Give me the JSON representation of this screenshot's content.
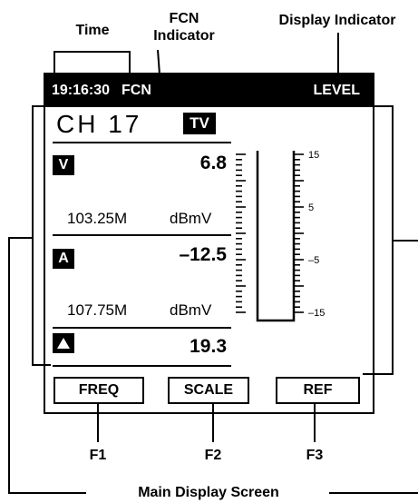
{
  "callouts": {
    "time": "Time",
    "fcn_line1": "FCN",
    "fcn_line2": "Indicator",
    "display_indicator": "Display Indicator",
    "main_display_screen": "Main Display Screen"
  },
  "status_bar": {
    "time": "19:16:30",
    "fcn": "FCN",
    "mode": "LEVEL"
  },
  "channel": {
    "label": "CH 17",
    "badge": "TV"
  },
  "video": {
    "badge": "V",
    "level": "6.8",
    "frequency": "103.25M",
    "unit": "dBmV"
  },
  "audio": {
    "badge": "A",
    "level": "–12.5",
    "frequency": "107.75M",
    "unit": "dBmV"
  },
  "delta": {
    "badge": "triangle-up-icon",
    "value": "19.3"
  },
  "scale": {
    "labels": [
      "15",
      "5",
      "–5",
      "–15"
    ]
  },
  "function_keys": [
    {
      "label": "FREQ",
      "key": "F1"
    },
    {
      "label": "SCALE",
      "key": "F2"
    },
    {
      "label": "REF",
      "key": "F3"
    }
  ]
}
